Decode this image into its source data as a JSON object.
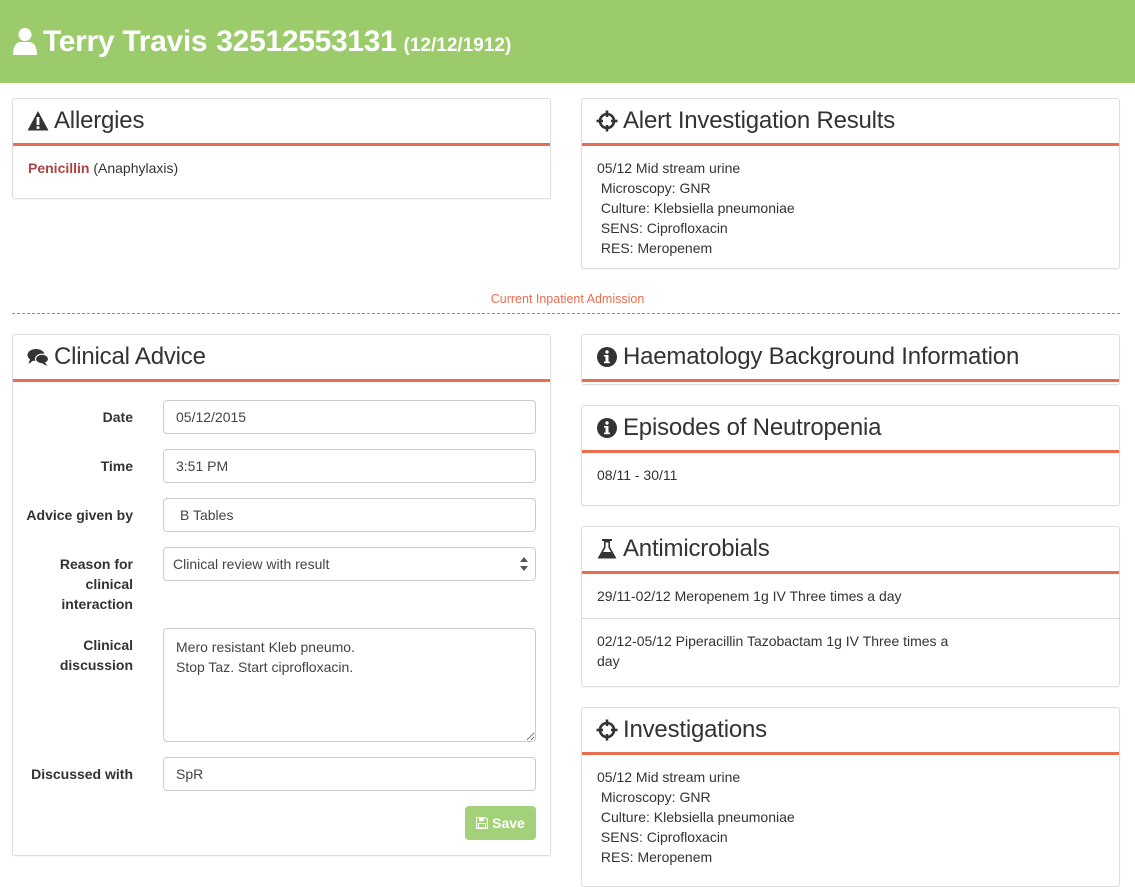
{
  "patient": {
    "name": "Terry Travis",
    "id": "32512553131",
    "dob": "(12/12/1912)"
  },
  "allergies": {
    "title": "Allergies",
    "items": [
      {
        "substance": "Penicillin",
        "reaction": "(Anaphylaxis)"
      }
    ]
  },
  "alert_results": {
    "title": "Alert Investigation Results",
    "lines": [
      "05/12 Mid stream urine",
      " Microscopy: GNR",
      " Culture: Klebsiella pneumoniae",
      " SENS: Ciprofloxacin",
      " RES: Meropenem"
    ]
  },
  "admission_divider": "Current Inpatient Admission",
  "clinical_advice": {
    "title": "Clinical Advice",
    "date_label": "Date",
    "date_value": "05/12/2015",
    "time_label": "Time",
    "time_value": "3:51 PM",
    "advice_label": "Advice given by",
    "advice_value": "B Tables",
    "reason_label_1": "Reason for",
    "reason_label_2": "clinical",
    "reason_label_3": "interaction",
    "reason_value": "Clinical review with result",
    "discussion_label_1": "Clinical",
    "discussion_label_2": "discussion",
    "discussion_value": "Mero resistant Kleb pneumo.\nStop Taz. Start ciprofloxacin.",
    "discussed_label": "Discussed with",
    "discussed_value": "SpR",
    "save_label": "Save"
  },
  "haematology": {
    "title": "Haematology Background Information"
  },
  "neutropenia": {
    "title": "Episodes of Neutropenia",
    "episodes": [
      "08/11 - 30/11"
    ]
  },
  "antimicrobials": {
    "title": "Antimicrobials",
    "items": [
      {
        "line1": "29/11-02/12 Meropenem 1g IV Three times a day",
        "line2": ""
      },
      {
        "line1": "02/12-05/12 Piperacillin Tazobactam 1g IV Three times a",
        "line2": "day"
      }
    ]
  },
  "investigations": {
    "title": "Investigations",
    "lines": [
      "05/12 Mid stream urine",
      " Microscopy: GNR",
      " Culture: Klebsiella pneumoniae",
      " SENS: Ciprofloxacin",
      " RES: Meropenem"
    ]
  },
  "colors": {
    "header_bg": "#9ccb6b",
    "accent": "#ea6d50",
    "allergen": "#a94442",
    "save_button": "#a3d17a"
  }
}
